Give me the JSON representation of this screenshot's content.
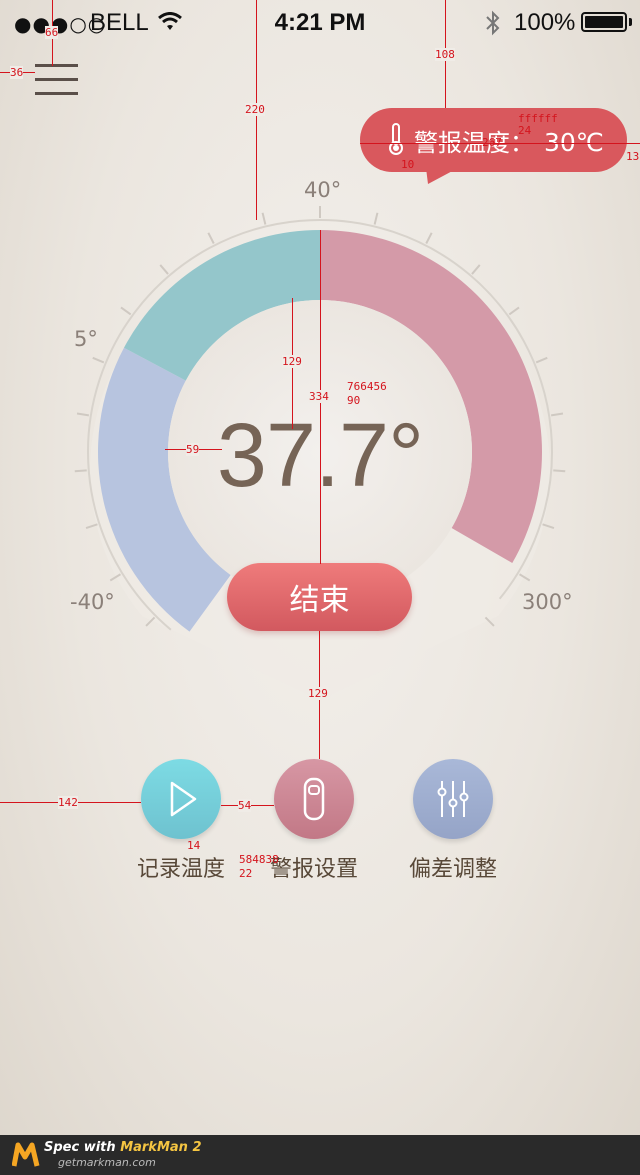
{
  "status_bar": {
    "carrier": "BELL",
    "time": "4:21 PM",
    "battery": "100%"
  },
  "alert": {
    "label": "警报温度：",
    "value": "30℃"
  },
  "gauge": {
    "labels": {
      "top": "40°",
      "left": "5°",
      "min": "-40°",
      "max": "300°"
    },
    "reading": "37.7°",
    "stop_label": "结束",
    "colors": {
      "cold": "#b7c4df",
      "cool": "#94c6cb",
      "warm": "#d49aa8"
    }
  },
  "actions": [
    {
      "label": "记录温度",
      "color": "#74d2dc"
    },
    {
      "label": "警报设置",
      "color": "#cc8a98"
    },
    {
      "label": "偏差调整",
      "color": "#9eaed0"
    }
  ],
  "footer": {
    "brand": "Spec with",
    "product": "MarkMan 2",
    "url": "getmarkman.com"
  },
  "annotations": {
    "menu_top": "66",
    "menu_left": "36",
    "alert_top": "108",
    "gauge_top": "220",
    "alert_font": "ffffff",
    "alert_size": "24",
    "alert_width": "267",
    "alert_pad": "10",
    "alert_right": "13",
    "ring_width": "129",
    "gauge_h": "334",
    "reading_color": "766456",
    "reading_size": "90",
    "ring_inner": "59",
    "btn_gap": "129",
    "act_left": "142",
    "act_gap": "54",
    "label_gap": "14",
    "label_color": "584838",
    "label_size": "22"
  }
}
